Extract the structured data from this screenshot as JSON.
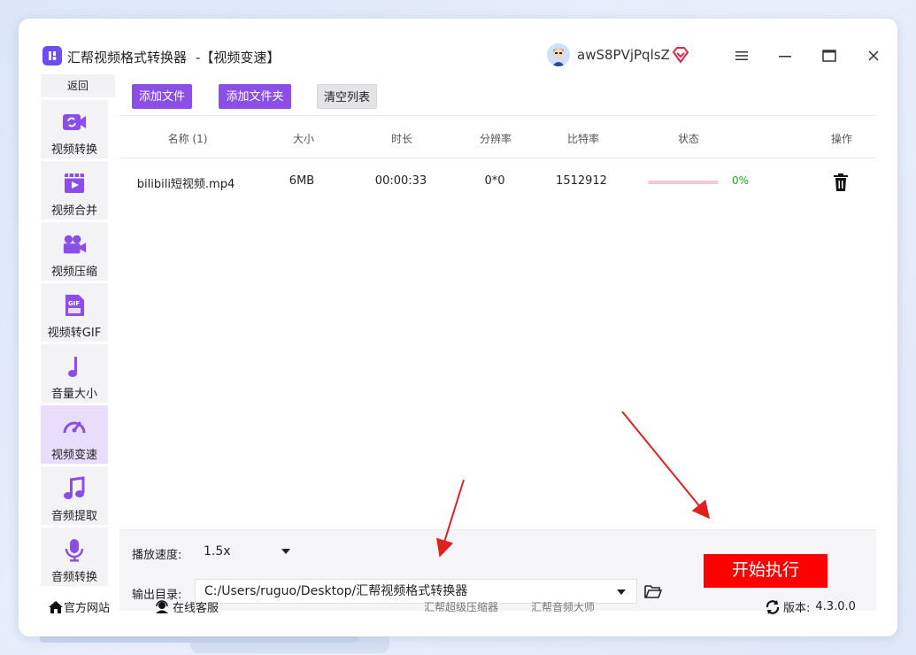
{
  "window": {
    "app_title": "汇帮视频格式转换器",
    "app_subtitle": "-【视频变速】",
    "username": "awS8PVjPqlsZ"
  },
  "sidebar": {
    "back_label": "返回",
    "items": [
      {
        "label": "视频转换",
        "icon": "video-convert-icon"
      },
      {
        "label": "视频合并",
        "icon": "video-merge-icon"
      },
      {
        "label": "视频压缩",
        "icon": "video-compress-icon"
      },
      {
        "label": "视频转GIF",
        "icon": "gif-icon"
      },
      {
        "label": "音量大小",
        "icon": "music-note-icon"
      },
      {
        "label": "视频变速",
        "icon": "speedometer-icon",
        "active": true
      },
      {
        "label": "音频提取",
        "icon": "audio-extract-icon"
      },
      {
        "label": "音频转换",
        "icon": "microphone-icon"
      }
    ]
  },
  "toolbar": {
    "add_file": "添加文件",
    "add_folder": "添加文件夹",
    "clear_list": "清空列表"
  },
  "table": {
    "headers": {
      "name": "名称 (1)",
      "size": "大小",
      "duration": "时长",
      "resolution": "分辨率",
      "bitrate": "比特率",
      "status": "状态",
      "actions": "操作"
    },
    "rows": [
      {
        "name": "bilibili短视频.mp4",
        "size": "6MB",
        "duration": "00:00:33",
        "resolution": "0*0",
        "bitrate": "1512912",
        "progress": 0,
        "progress_text": "0%"
      }
    ]
  },
  "settings": {
    "speed_label": "播放速度:",
    "speed_value": "1.5x",
    "output_label": "输出目录:",
    "output_path": "C:/Users/ruguo/Desktop/汇帮视频格式转换器",
    "start_button": "开始执行"
  },
  "footer": {
    "official_site": "官方网站",
    "online_service": "在线客服",
    "link_compressor": "汇帮超级压缩器",
    "link_audio": "汇帮音频大师",
    "version_label": "版本:",
    "version_value": "4.3.0.0"
  },
  "colors": {
    "accent_purple": "#8b4fe8",
    "start_red": "#ff0000",
    "progress_green": "#27a327",
    "sidebar_active": "#e8defb"
  }
}
